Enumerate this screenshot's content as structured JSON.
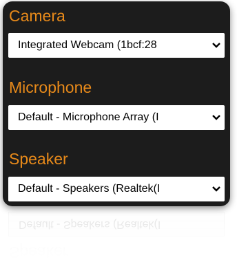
{
  "devices": {
    "camera": {
      "label": "Camera",
      "selected": "Integrated Webcam (1bcf:28"
    },
    "microphone": {
      "label": "Microphone",
      "selected": "Default - Microphone Array (I"
    },
    "speaker": {
      "label": "Speaker",
      "selected": "Default - Speakers (Realtek(I"
    }
  },
  "colors": {
    "panel_bg": "#1c1c1c",
    "label": "#e88a1a",
    "select_bg": "#ffffff"
  },
  "icons": {
    "dropdown": "chevron-down-icon"
  }
}
